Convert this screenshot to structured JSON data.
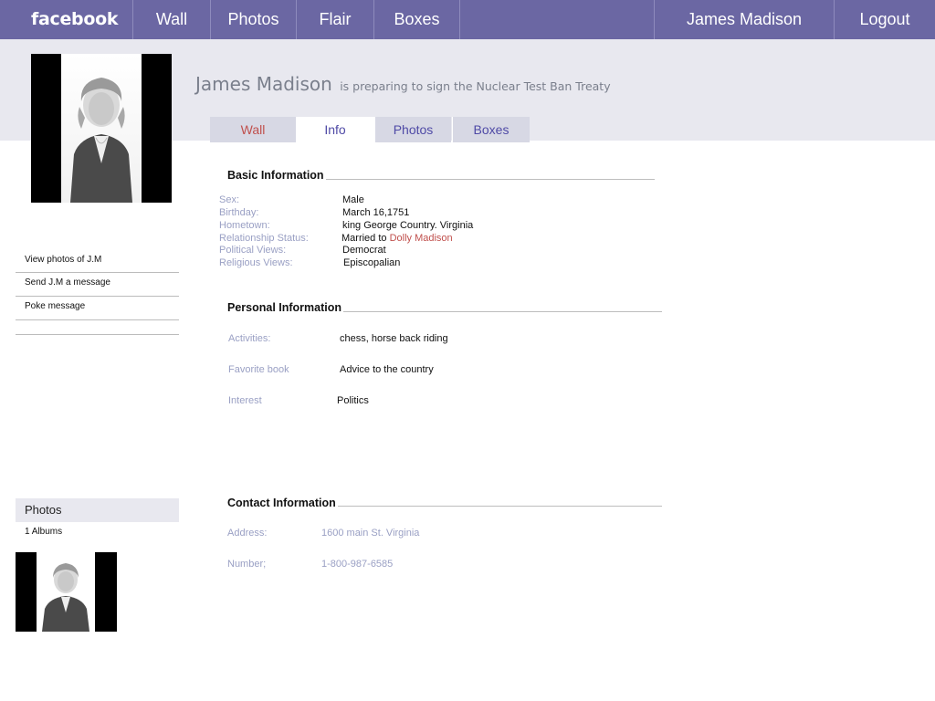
{
  "nav": {
    "logo": "facebook",
    "items": [
      "Wall",
      "Photos",
      "Flair",
      "Boxes"
    ],
    "user": "James Madison",
    "logout": "Logout"
  },
  "profile": {
    "name": "James Madison",
    "status": "is preparing to sign the Nuclear Test Ban Treaty"
  },
  "tabs": [
    "Wall",
    "Info",
    "Photos",
    "Boxes"
  ],
  "active_tab": "Info",
  "sidebar": {
    "links": [
      "View photos of J.M",
      "Send J.M a message",
      "Poke message"
    ],
    "photos_heading": "Photos",
    "albums": "1 Albums"
  },
  "basic": {
    "title": "Basic Information",
    "rows": [
      {
        "label": "Sex:",
        "value": "Male"
      },
      {
        "label": "Birthday:",
        "value": "March 16,1751"
      },
      {
        "label": "Hometown:",
        "value": "king George Country. Virginia"
      },
      {
        "label": "Relationship Status:",
        "value_prefix": "Married to ",
        "value_link": "Dolly Madison"
      },
      {
        "label": "Political Views:",
        "value": "Democrat"
      },
      {
        "label": "Religious Views:",
        "value": "Episcopalian"
      }
    ]
  },
  "personal": {
    "title": "Personal Information",
    "rows": [
      {
        "label": "Activities:",
        "value": "chess, horse back riding"
      },
      {
        "label": "Favorite book",
        "value": "Advice to the country"
      },
      {
        "label": "Interest",
        "value": "Politics"
      }
    ]
  },
  "contact": {
    "title": "Contact Information",
    "rows": [
      {
        "label": "Address:",
        "value": "1600  main St.  Virginia"
      },
      {
        "label": "Number;",
        "value": "1-800-987-6585"
      }
    ]
  },
  "colors": {
    "nav_bg": "#6b67a3",
    "header_band": "#e8e8ef",
    "tab_inactive": "#d7d8e4",
    "link_red": "#c0504d",
    "label_blue": "#9aa0c4"
  }
}
